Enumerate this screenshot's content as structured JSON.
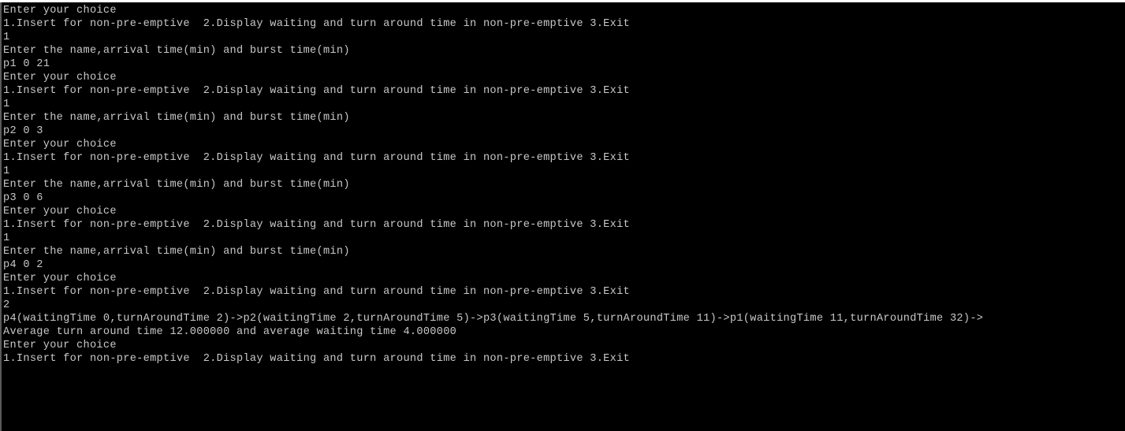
{
  "console": {
    "lines": [
      "Enter your choice",
      "1.Insert for non-pre-emptive  2.Display waiting and turn around time in non-pre-emptive 3.Exit",
      "1",
      "Enter the name,arrival time(min) and burst time(min)",
      "p1 0 21",
      "Enter your choice",
      "1.Insert for non-pre-emptive  2.Display waiting and turn around time in non-pre-emptive 3.Exit",
      "1",
      "Enter the name,arrival time(min) and burst time(min)",
      "p2 0 3",
      "Enter your choice",
      "1.Insert for non-pre-emptive  2.Display waiting and turn around time in non-pre-emptive 3.Exit",
      "1",
      "Enter the name,arrival time(min) and burst time(min)",
      "p3 0 6",
      "Enter your choice",
      "1.Insert for non-pre-emptive  2.Display waiting and turn around time in non-pre-emptive 3.Exit",
      "1",
      "Enter the name,arrival time(min) and burst time(min)",
      "p4 0 2",
      "Enter your choice",
      "1.Insert for non-pre-emptive  2.Display waiting and turn around time in non-pre-emptive 3.Exit",
      "2",
      "p4(waitingTime 0,turnAroundTime 2)->p2(waitingTime 2,turnAroundTime 5)->p3(waitingTime 5,turnAroundTime 11)->p1(waitingTime 11,turnAroundTime 32)->",
      "Average turn around time 12.000000 and average waiting time 4.000000",
      "Enter your choice",
      "1.Insert for non-pre-emptive  2.Display waiting and turn around time in non-pre-emptive 3.Exit"
    ]
  },
  "colors": {
    "background": "#000000",
    "text": "#c8c8c8"
  }
}
